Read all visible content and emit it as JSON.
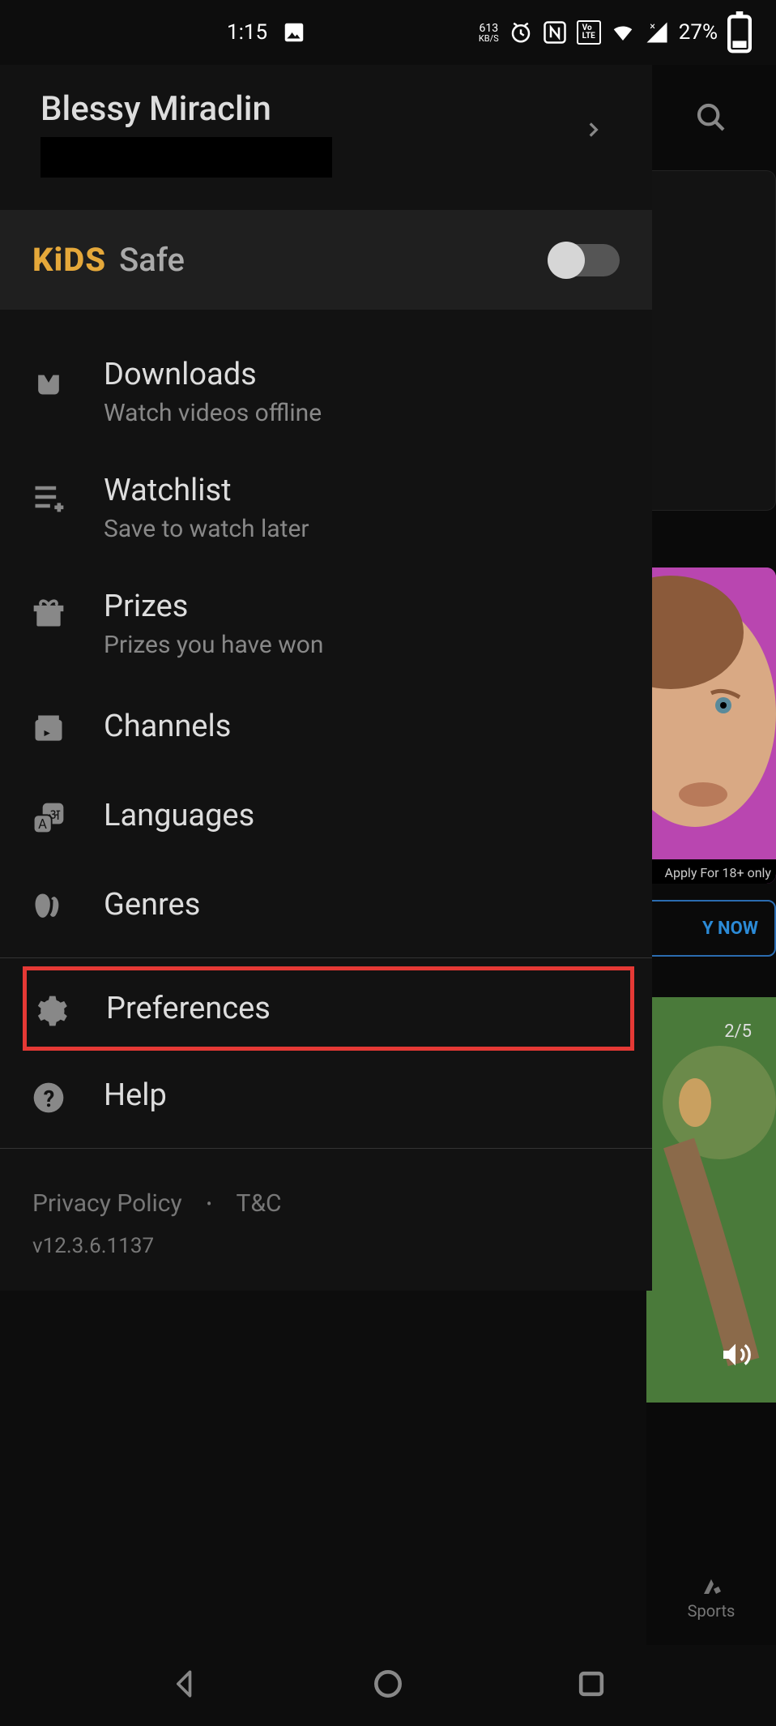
{
  "statusBar": {
    "time": "1:15",
    "networkSpeed": "613",
    "networkUnit": "KB/S",
    "battery": "27%"
  },
  "profile": {
    "name": "Blessy Miraclin"
  },
  "kidsSafe": {
    "kidsText": "KiDS",
    "safeText": "Safe"
  },
  "menu": {
    "downloads": {
      "title": "Downloads",
      "subtitle": "Watch videos offline"
    },
    "watchlist": {
      "title": "Watchlist",
      "subtitle": "Save to watch later"
    },
    "prizes": {
      "title": "Prizes",
      "subtitle": "Prizes you have won"
    },
    "channels": {
      "title": "Channels"
    },
    "languages": {
      "title": "Languages"
    },
    "genres": {
      "title": "Genres"
    },
    "preferences": {
      "title": "Preferences"
    },
    "help": {
      "title": "Help"
    }
  },
  "footer": {
    "privacy": "Privacy Policy",
    "terms": "T&C",
    "version": "v12.3.6.1137"
  },
  "background": {
    "faceLabel": "Apply For 18+ only",
    "buttonLabel": "Y NOW",
    "pageIndicator": "2/5",
    "navLabel": "Sports"
  }
}
